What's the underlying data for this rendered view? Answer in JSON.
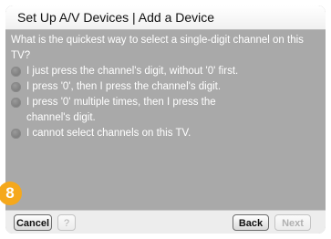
{
  "title": "Set Up A/V Devices | Add a Device",
  "question": "What is the quickest way to select a single-digit channel on this TV?",
  "options": [
    {
      "line1": "I just press the channel's digit, without '0' first.",
      "line2": ""
    },
    {
      "line1": "I press '0', then I press the channel's digit.",
      "line2": ""
    },
    {
      "line1": "I press '0' multiple times, then I press the",
      "line2": "channel's digit."
    },
    {
      "line1": "I cannot select channels on this TV.",
      "line2": ""
    }
  ],
  "step_badge": "8",
  "buttons": {
    "cancel": "Cancel",
    "help": "?",
    "back": "Back",
    "next": "Next"
  },
  "colors": {
    "panel": "#a9a9a9",
    "badge": "#f5a81c"
  }
}
